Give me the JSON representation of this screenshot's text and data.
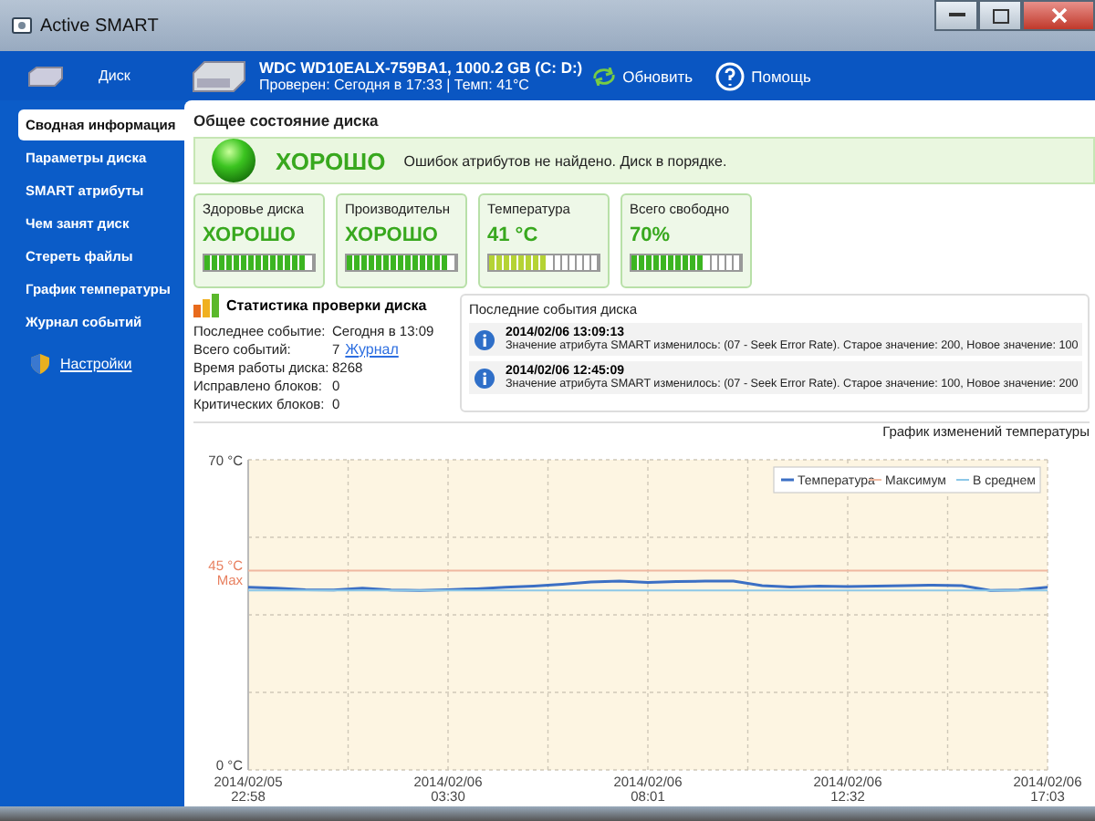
{
  "window": {
    "title": "Active SMART"
  },
  "header": {
    "disk_label": "Диск",
    "drive_name": "WDC WD10EALX-759BA1, 1000.2 GB (C: D:)",
    "drive_info": "Проверен: Сегодня в 17:33 | Темп: 41°C",
    "refresh": "Обновить",
    "help": "Помощь"
  },
  "sidebar": {
    "items": [
      {
        "label": "Сводная информация",
        "selected": true
      },
      {
        "label": "Параметры диска",
        "selected": false
      },
      {
        "label": "SMART атрибуты",
        "selected": false
      },
      {
        "label": "Чем занят диск",
        "selected": false
      },
      {
        "label": "Стереть файлы",
        "selected": false
      },
      {
        "label": "График температуры",
        "selected": false
      },
      {
        "label": "Журнал событий",
        "selected": false
      }
    ],
    "settings": "Настройки"
  },
  "overview": {
    "title": "Общее состояние диска",
    "status": "ХОРОШО",
    "message": "Ошибок атрибутов не найдено. Диск в порядке."
  },
  "cards": [
    {
      "title": "Здоровье диска",
      "value": "ХОРОШО",
      "level": 0.93,
      "color": "#3cb521"
    },
    {
      "title": "Производительн",
      "value": "ХОРОШО",
      "level": 0.93,
      "color": "#3cb521"
    },
    {
      "title": "Температура",
      "value": "41 °C",
      "level": 0.53,
      "color": "#b5d334"
    },
    {
      "title": "Всего свободно",
      "value": "70%",
      "level": 0.67,
      "color": "#3cb521"
    }
  ],
  "stats": {
    "title": "Статистика проверки диска",
    "rows": [
      {
        "label": "Последнее событие:",
        "value": "Сегодня в 13:09"
      },
      {
        "label": "Всего событий:",
        "value": "7",
        "link": "Журнал"
      },
      {
        "label": "Время работы диска:",
        "value": "8268"
      },
      {
        "label": "Исправлено блоков:",
        "value": "0"
      },
      {
        "label": "Критических блоков:",
        "value": "0"
      }
    ]
  },
  "events": {
    "title": "Последние события диска",
    "items": [
      {
        "time": "2014/02/06 13:09:13",
        "text": "Значение атрибута SMART изменилось: (07 - Seek Error Rate). Старое значение: 200, Новое значение: 100"
      },
      {
        "time": "2014/02/06 12:45:09",
        "text": "Значение атрибута SMART изменилось: (07 - Seek Error Rate). Старое значение: 100, Новое значение: 200"
      }
    ]
  },
  "temperature_chart": {
    "chart_data": {
      "type": "line",
      "title": "График изменений температуры",
      "categories": [
        "2014/02/05 22:58",
        null,
        null,
        null,
        null,
        null,
        null,
        "2014/02/06 03:30",
        null,
        null,
        null,
        null,
        null,
        null,
        "2014/02/06 08:01",
        null,
        null,
        null,
        null,
        null,
        null,
        "2014/02/06 12:32",
        null,
        null,
        null,
        null,
        null,
        null,
        "2014/02/06 17:03"
      ],
      "series": [
        {
          "name": "Температура",
          "color": "#3b6fc4",
          "values": [
            41.2,
            41.0,
            40.7,
            40.6,
            41.0,
            40.6,
            40.5,
            40.7,
            40.9,
            41.2,
            41.5,
            41.9,
            42.4,
            42.6,
            42.3,
            42.5,
            42.6,
            42.6,
            41.6,
            41.3,
            41.5,
            41.4,
            41.5,
            41.6,
            41.7,
            41.6,
            40.5,
            40.6,
            41.2
          ]
        },
        {
          "name": "Максимум",
          "color": "#f0b8a0",
          "values": [
            45,
            45,
            45,
            45,
            45,
            45,
            45,
            45,
            45,
            45,
            45,
            45,
            45,
            45,
            45,
            45,
            45,
            45,
            45,
            45,
            45,
            45,
            45,
            45,
            45,
            45,
            45,
            45,
            45
          ]
        },
        {
          "name": "В среднем",
          "color": "#8cc8e8",
          "values": [
            40.5,
            40.5,
            40.5,
            40.5,
            40.5,
            40.5,
            40.5,
            40.5,
            40.5,
            40.5,
            40.5,
            40.5,
            40.5,
            40.5,
            40.5,
            40.5,
            40.5,
            40.5,
            40.5,
            40.5,
            40.5,
            40.5,
            40.5,
            40.5,
            40.5,
            40.5,
            40.5,
            40.5,
            40.5
          ]
        }
      ],
      "ylim": [
        0,
        70
      ],
      "yticks": [
        {
          "value": 0,
          "label": "0 °C"
        },
        {
          "value": 45,
          "label": "45 °C"
        },
        {
          "value": 70,
          "label": "70 °C"
        }
      ],
      "annotations": [
        "Max"
      ],
      "grid": true,
      "legend": "upper right"
    }
  }
}
